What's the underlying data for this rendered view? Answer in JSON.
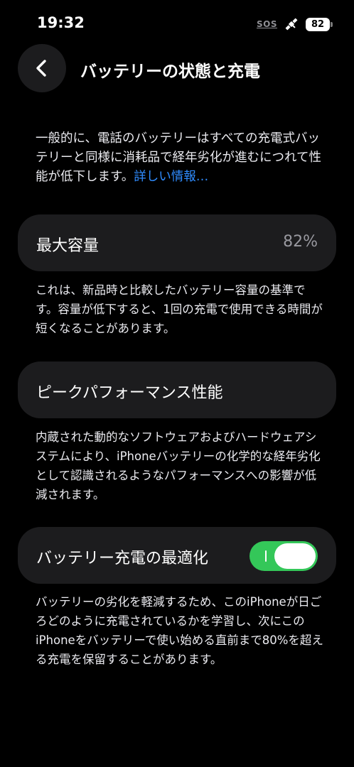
{
  "status_bar": {
    "time": "19:32",
    "sos": "SOS",
    "battery_level": "82"
  },
  "nav": {
    "title": "バッテリーの状態と充電"
  },
  "intro": {
    "text": "一般的に、電話のバッテリーはすべての充電式バッテリーと同様に消耗品で経年劣化が進むにつれて性能が低下します。",
    "link": "詳しい情報…"
  },
  "max_capacity": {
    "label": "最大容量",
    "value": "82%",
    "footer": "これは、新品時と比較したバッテリー容量の基準です。容量が低下すると、1回の充電で使用できる時間が短くなることがあります。"
  },
  "peak_performance": {
    "label": "ピークパフォーマンス性能",
    "footer": "内蔵された動的なソフトウェアおよびハードウェアシステムにより、iPhoneバッテリーの化学的な経年劣化として認識されるようなパフォーマンスへの影響が低減されます。"
  },
  "optimized_charging": {
    "label": "バッテリー充電の最適化",
    "enabled": true,
    "footer": "バッテリーの劣化を軽減するため、このiPhoneが日ごろどのように充電されているかを学習し、次にこのiPhoneをバッテリーで使い始める直前まで80%を超える充電を保留することがあります。"
  },
  "colors": {
    "background": "#000000",
    "cell": "#1C1C1E",
    "accent_link": "#2F8CFF",
    "toggle_on": "#34C759"
  }
}
